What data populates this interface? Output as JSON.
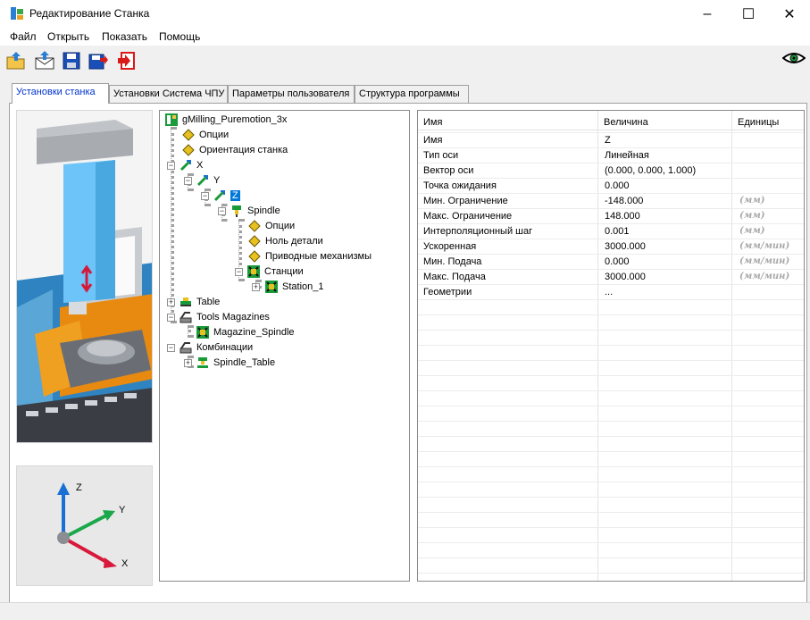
{
  "window": {
    "title": "Редактирование Станка",
    "icon": "machine-app-icon",
    "controls": {
      "minimize": "–",
      "maximize": "☐",
      "close": "✕"
    }
  },
  "menu": [
    {
      "label": "Файл"
    },
    {
      "label": "Открыть"
    },
    {
      "label": "Показать"
    },
    {
      "label": "Помощь"
    }
  ],
  "toolbar": {
    "buttons": [
      "open-folder-icon",
      "import-envelope-icon",
      "save-icon",
      "save-as-icon",
      "exit-icon"
    ],
    "right_icon": "eye-icon"
  },
  "tabs": [
    {
      "label": "Установки станка",
      "active": true
    },
    {
      "label": "Установки Система ЧПУ",
      "active": false
    },
    {
      "label": "Параметры пользователя",
      "active": false
    },
    {
      "label": "Структура программы",
      "active": false
    }
  ],
  "axes_widget": {
    "z": "Z",
    "y": "Y",
    "x": "X"
  },
  "tree": [
    {
      "label": "gMilling_Puremotion_3x",
      "icon": "machine-root-icon",
      "level": 0
    },
    {
      "label": "Опции",
      "icon": "diamond-icon",
      "level": 1
    },
    {
      "label": "Ориентация станка",
      "icon": "diamond-icon",
      "level": 1
    },
    {
      "label": "X",
      "icon": "axis-icon",
      "level": 0,
      "expander": "−"
    },
    {
      "label": "Y",
      "icon": "axis-icon",
      "level": 1,
      "expander": "−"
    },
    {
      "label": "Z",
      "icon": "axis-icon",
      "level": 2,
      "expander": "−",
      "selected": true
    },
    {
      "label": "Spindle",
      "icon": "spindle-icon",
      "level": 3,
      "expander": "−"
    },
    {
      "label": "Опции",
      "icon": "diamond-icon",
      "level": 4
    },
    {
      "label": "Ноль детали",
      "icon": "diamond-icon",
      "level": 4
    },
    {
      "label": "Приводные механизмы",
      "icon": "diamond-icon",
      "level": 4
    },
    {
      "label": "Станции",
      "icon": "station-icon",
      "level": 4,
      "expander": "−"
    },
    {
      "label": "Station_1",
      "icon": "station-icon",
      "level": 5,
      "expander": "+"
    },
    {
      "label": "Table",
      "icon": "table-icon",
      "level": 0,
      "expander": "+"
    },
    {
      "label": "Tools Magazines",
      "icon": "magazine-icon",
      "level": 0,
      "expander": "−"
    },
    {
      "label": "Magazine_Spindle",
      "icon": "station-icon",
      "level": 1
    },
    {
      "label": "Комбинации",
      "icon": "combination-icon",
      "level": 0,
      "expander": "−"
    },
    {
      "label": "Spindle_Table",
      "icon": "spindle-table-icon",
      "level": 1,
      "expander": "+"
    }
  ],
  "properties": {
    "headers": {
      "name": "Имя",
      "value": "Величина",
      "units": "Единицы"
    },
    "rows": [
      {
        "name": "Имя",
        "value": "Z",
        "units": ""
      },
      {
        "name": "Тип оси",
        "value": "Линейная",
        "units": ""
      },
      {
        "name": "Вектор оси",
        "value": "(0.000, 0.000, 1.000)",
        "units": ""
      },
      {
        "name": "Точка ожидания",
        "value": "0.000",
        "units": ""
      },
      {
        "name": "Мин. Ограничение",
        "value": "-148.000",
        "units": "(мм)"
      },
      {
        "name": "Макс. Ограничение",
        "value": "148.000",
        "units": "(мм)"
      },
      {
        "name": "Интерполяционный шаг",
        "value": "0.001",
        "units": "(мм)"
      },
      {
        "name": "Ускоренная",
        "value": "3000.000",
        "units": "(мм/мин)"
      },
      {
        "name": "Мин. Подача",
        "value": "0.000",
        "units": "(мм/мин)"
      },
      {
        "name": "Макс. Подача",
        "value": "3000.000",
        "units": "(мм/мин)"
      },
      {
        "name": "Геометрии",
        "value": "...",
        "units": ""
      }
    ]
  }
}
